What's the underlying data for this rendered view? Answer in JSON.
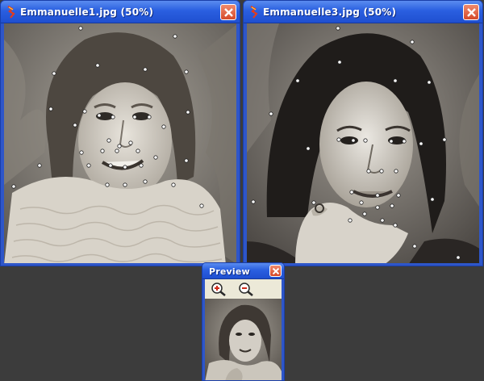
{
  "windows": [
    {
      "title": "Emmanuelle1.jpg  (50%)",
      "icon": "app-icon",
      "close_icon": "close-icon"
    },
    {
      "title": "Emmanuelle3.jpg  (50%)",
      "icon": "app-icon",
      "close_icon": "close-icon"
    }
  ],
  "preview": {
    "title": "Preview",
    "close_icon": "close-icon",
    "toolbar": [
      {
        "icon": "zoom-in-icon"
      },
      {
        "icon": "zoom-out-icon"
      }
    ]
  },
  "colors": {
    "desktop": "#3c3c3c",
    "titlebar": "#2a5fe0",
    "close": "#d54a2a"
  }
}
